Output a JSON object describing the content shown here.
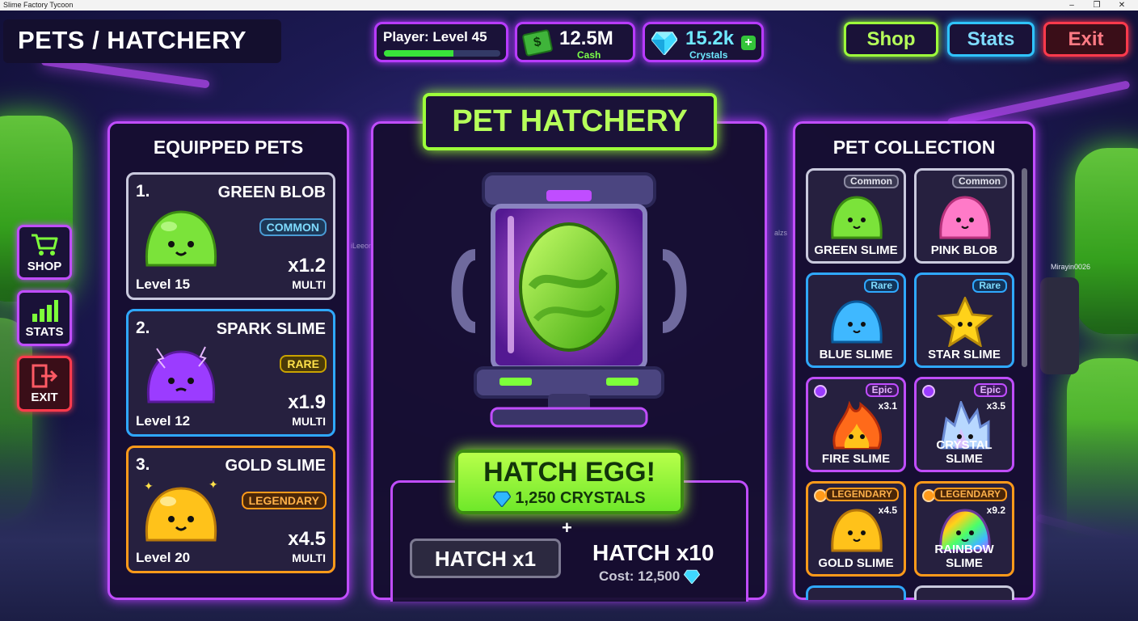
{
  "window": {
    "title": "Slime Factory Tycoon"
  },
  "page_title": "PETS / HATCHERY",
  "hud": {
    "level_label": "Player: Level 45",
    "level_progress": 0.6,
    "cash_value": "12.5M",
    "cash_label": "Cash",
    "crystals_value": "15.2k",
    "crystals_label": "Crystals",
    "plus_symbol": "+"
  },
  "top_nav": {
    "shop": "Shop",
    "stats": "Stats",
    "exit": "Exit"
  },
  "side_nav": {
    "shop": "SHOP",
    "stats": "STATS",
    "exit": "EXIT"
  },
  "equipped": {
    "title": "EQUIPPED PETS",
    "pets": [
      {
        "num": "1.",
        "name": "GREEN BLOB",
        "rarity": "COMMON",
        "mult": "x1.2",
        "mult_label": "MULTI",
        "level": "Level 15"
      },
      {
        "num": "2.",
        "name": "SPARK SLIME",
        "rarity": "RARE",
        "mult": "x1.9",
        "mult_label": "MULTI",
        "level": "Level 12"
      },
      {
        "num": "3.",
        "name": "GOLD SLIME",
        "rarity": "LEGENDARY",
        "mult": "x4.5",
        "mult_label": "MULTI",
        "level": "Level 20"
      }
    ]
  },
  "hatchery": {
    "title": "PET HATCHERY",
    "hatch_egg": "HATCH EGG!",
    "hatch_cost": "1,250 CRYSTALS",
    "plus": "+",
    "hatch_x1": "HATCH x1",
    "hatch_x10": "HATCH x10",
    "hatch_x10_cost": "Cost: 12,500"
  },
  "collection": {
    "title": "PET COLLECTION",
    "items": [
      {
        "name": "GREEN SLIME",
        "rarity": "Common",
        "mult": ""
      },
      {
        "name": "PINK BLOB",
        "rarity": "Common",
        "mult": ""
      },
      {
        "name": "BLUE SLIME",
        "rarity": "Rare",
        "mult": ""
      },
      {
        "name": "STAR SLIME",
        "rarity": "Rare",
        "mult": ""
      },
      {
        "name": "FIRE SLIME",
        "rarity": "Epic",
        "mult": "x3.1"
      },
      {
        "name": "CRYSTAL SLIME",
        "rarity": "Epic",
        "mult": "x3.5"
      },
      {
        "name": "GOLD SLIME",
        "rarity": "LEGENDARY",
        "mult": "x4.5"
      },
      {
        "name": "RAINBOW SLIME",
        "rarity": "LEGENDARY",
        "mult": "x9.2"
      }
    ]
  },
  "background_players": {
    "right": "Mirayin0026",
    "mid_left": "iLeeon",
    "mid_right": "alzs"
  },
  "colors": {
    "neon_green": "#9dff3a",
    "neon_purple": "#c04dff",
    "neon_blue": "#2fc4ff",
    "neon_red": "#ff3a4c",
    "legendary_orange": "#ff9a1a"
  }
}
